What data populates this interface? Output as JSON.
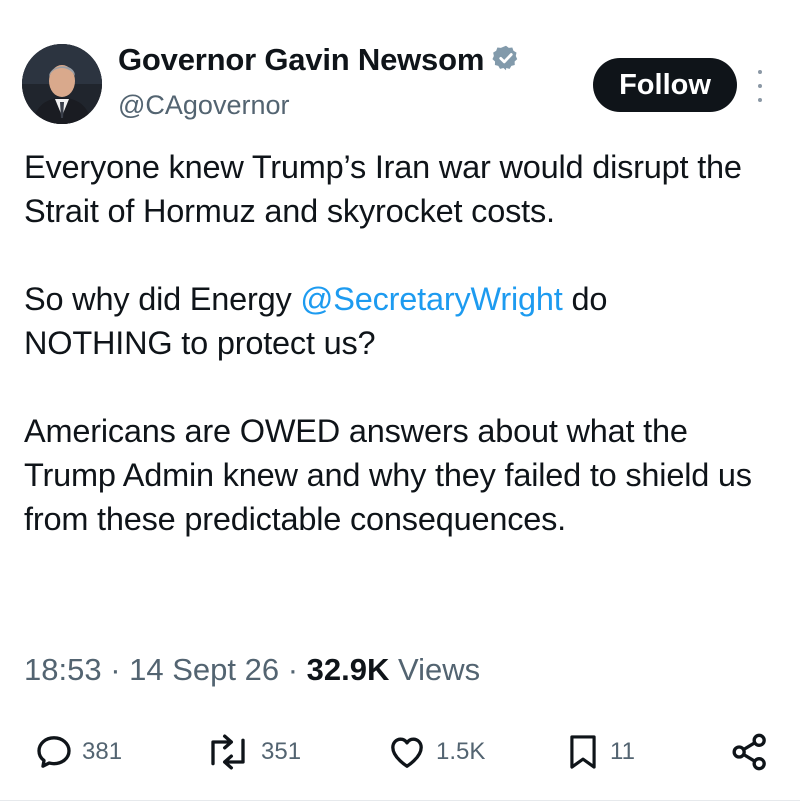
{
  "author": {
    "name": "Governor Gavin Newsom",
    "handle": "@CAgovernor",
    "verified_icon": "verified-badge-icon"
  },
  "follow_label": "Follow",
  "tweet": {
    "p1": "Everyone knew Trump’s Iran war would disrupt the Strait of Hormuz and skyrocket costs.",
    "p2_before": "So why did Energy ",
    "p2_mention": "@SecretaryWright",
    "p2_after": " do NOTHING to protect us?",
    "p3": "Americans are OWED answers about what the Trump Admin knew and why they failed to shield us from these predictable consequences."
  },
  "meta": {
    "time": "18:53",
    "sep": " · ",
    "date": "14 Sept 26",
    "views_count": "32.9K",
    "views_label": " Views"
  },
  "actions": {
    "replies": "381",
    "reposts": "351",
    "likes": "1.5K",
    "bookmarks": "11"
  },
  "colors": {
    "mention": "#1d9bf0",
    "verified": "#829aab",
    "text": "#0f1419",
    "muted": "#536471"
  }
}
